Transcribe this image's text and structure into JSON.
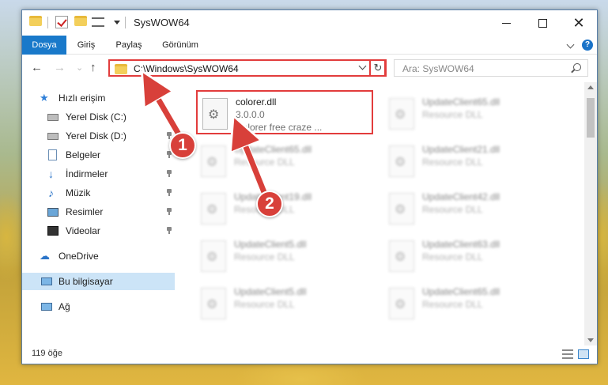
{
  "window": {
    "title": "SysWOW64"
  },
  "ribbon": {
    "tabs": [
      {
        "label": "Dosya",
        "active": true
      },
      {
        "label": "Giriş",
        "active": false
      },
      {
        "label": "Paylaş",
        "active": false
      },
      {
        "label": "Görünüm",
        "active": false
      }
    ],
    "help_label": "?"
  },
  "nav": {
    "back_glyph": "←",
    "forward_glyph": "→",
    "recent_glyph": "⌄",
    "up_glyph": "↑",
    "address": "C:\\Windows\\SysWOW64",
    "refresh_glyph": "↻",
    "search_placeholder": "Ara: SysWOW64"
  },
  "sidebar": {
    "items": [
      {
        "label": "Hızlı erişim",
        "icon": "star-icon",
        "pinned": false
      },
      {
        "label": "Yerel Disk (C:)",
        "icon": "disk-icon",
        "pinned": false
      },
      {
        "label": "Yerel Disk (D:)",
        "icon": "disk-icon",
        "pinned": true
      },
      {
        "label": "Belgeler",
        "icon": "document-icon",
        "pinned": true
      },
      {
        "label": "İndirmeler",
        "icon": "download-icon",
        "pinned": true
      },
      {
        "label": "Müzik",
        "icon": "music-icon",
        "pinned": true
      },
      {
        "label": "Resimler",
        "icon": "picture-icon",
        "pinned": true
      },
      {
        "label": "Videolar",
        "icon": "video-icon",
        "pinned": true
      },
      {
        "label": "OneDrive",
        "icon": "cloud-icon",
        "pinned": false
      },
      {
        "label": "Bu bilgisayar",
        "icon": "computer-icon",
        "pinned": false,
        "selected": true
      },
      {
        "label": "Ağ",
        "icon": "network-icon",
        "pinned": false
      }
    ]
  },
  "files": [
    {
      "name": "colorer.dll",
      "version": "3.0.0.0",
      "description": "Colorer free craze ...",
      "highlighted": true
    },
    {
      "name": "UpdateClient65.dll",
      "type": "Resource DLL"
    },
    {
      "name": "UpdateClient65.dll",
      "type": "Resource DLL"
    },
    {
      "name": "UpdateClient21.dll",
      "type": "Resource DLL"
    },
    {
      "name": "UpdateClient19.dll",
      "type": "Resource DLL"
    },
    {
      "name": "UpdateClient42.dll",
      "type": "Resource DLL"
    },
    {
      "name": "UpdateClient5.dll",
      "type": "Resource DLL"
    },
    {
      "name": "UpdateClient63.dll",
      "type": "Resource DLL"
    },
    {
      "name": "UpdateClient5.dll",
      "type": "Resource DLL"
    },
    {
      "name": "UpdateClient65.dll",
      "type": "Resource DLL"
    }
  ],
  "status": {
    "item_count": "119 öğe"
  },
  "annotations": {
    "step1": "1",
    "step2": "2",
    "color": "#d8403a"
  }
}
